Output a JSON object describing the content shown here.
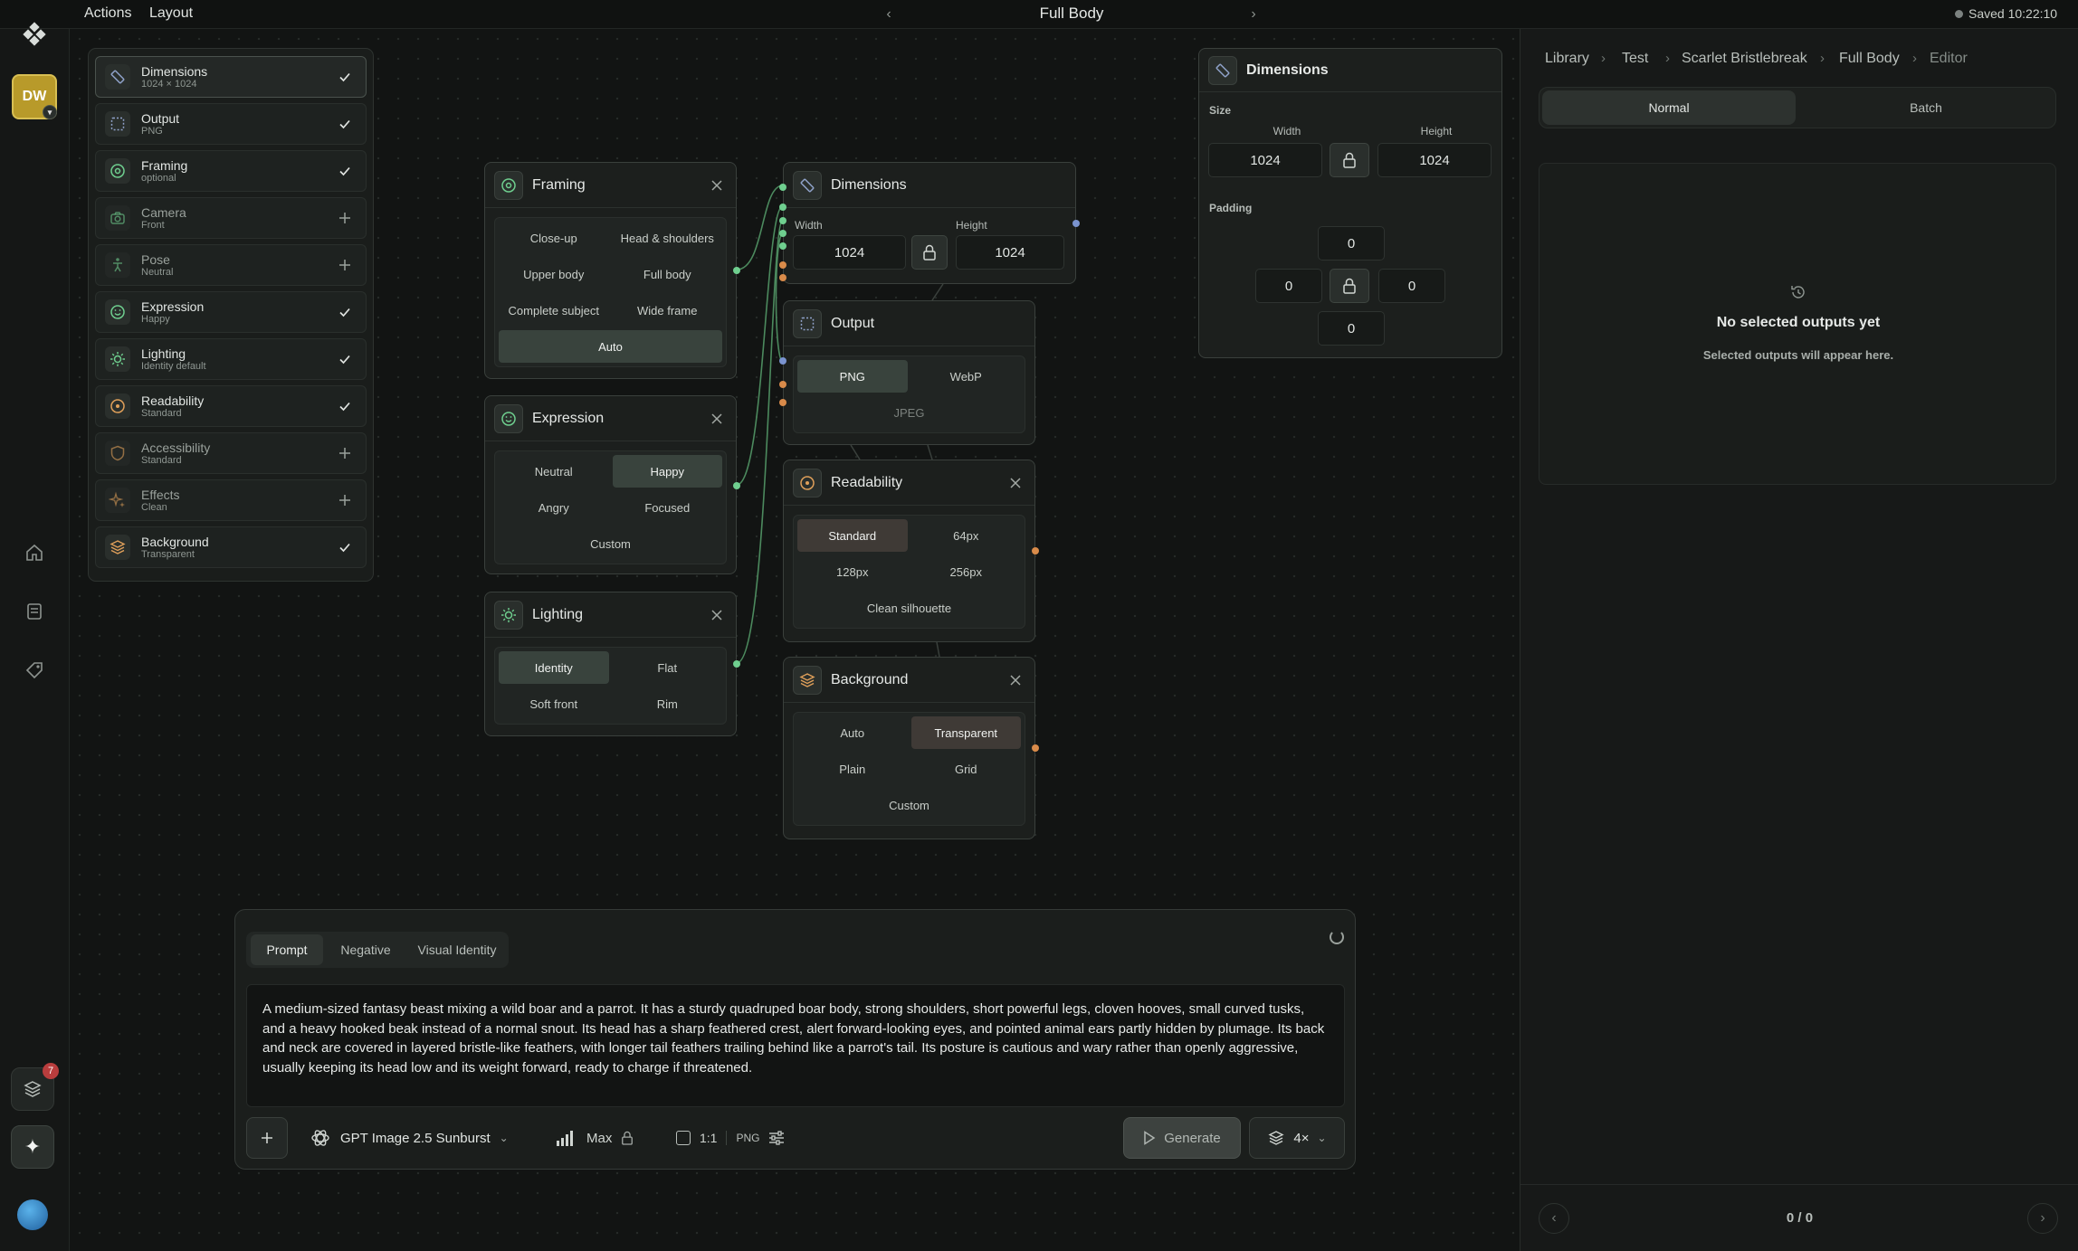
{
  "topbar": {
    "menu": [
      "Actions",
      "Layout"
    ],
    "title": "Full Body",
    "saved": "Saved 10:22:10"
  },
  "rail": {
    "avatar": "DW",
    "badge": "7"
  },
  "steps": [
    {
      "label": "Dimensions",
      "sub": "1024 × 1024",
      "state": "done",
      "icon": "ruler-icon",
      "color": "#8fa2c9"
    },
    {
      "label": "Output",
      "sub": "PNG",
      "state": "done",
      "icon": "output-frame-icon",
      "color": "#8fa2c9"
    },
    {
      "label": "Framing",
      "sub": "optional",
      "state": "done",
      "icon": "framing-target-icon",
      "color": "#6fcf8f"
    },
    {
      "label": "Camera",
      "sub": "Front",
      "state": "add",
      "icon": "camera-icon",
      "color": "#6fcf8f"
    },
    {
      "label": "Pose",
      "sub": "Neutral",
      "state": "add",
      "icon": "pose-figure-icon",
      "color": "#6fcf8f"
    },
    {
      "label": "Expression",
      "sub": "Happy",
      "state": "done",
      "icon": "smile-icon",
      "color": "#6fcf8f"
    },
    {
      "label": "Lighting",
      "sub": "Identity default",
      "state": "done",
      "icon": "sun-icon",
      "color": "#6fcf8f"
    },
    {
      "label": "Readability",
      "sub": "Standard",
      "state": "done",
      "icon": "readability-icon",
      "color": "#e0a05a"
    },
    {
      "label": "Accessibility",
      "sub": "Standard",
      "state": "add",
      "icon": "shield-icon",
      "color": "#e0a05a"
    },
    {
      "label": "Effects",
      "sub": "Clean",
      "state": "add",
      "icon": "sparkle-effects-icon",
      "color": "#e0a05a"
    },
    {
      "label": "Background",
      "sub": "Transparent",
      "state": "done",
      "icon": "layers-icon",
      "color": "#e0a05a"
    }
  ],
  "nodes": {
    "framing": {
      "title": "Framing",
      "options": [
        "Close-up",
        "Head & shoulders",
        "Upper body",
        "Full body",
        "Complete subject",
        "Wide frame"
      ],
      "auto": "Auto"
    },
    "expression": {
      "title": "Expression",
      "options": [
        "Neutral",
        "Happy",
        "Angry",
        "Focused"
      ],
      "custom": "Custom"
    },
    "lighting": {
      "title": "Lighting",
      "options": [
        "Identity",
        "Flat",
        "Soft front",
        "Rim"
      ]
    },
    "dimensions": {
      "title": "Dimensions",
      "width_label": "Width",
      "height_label": "Height",
      "width": "1024",
      "height": "1024"
    },
    "output": {
      "title": "Output",
      "options": [
        "PNG",
        "WebP"
      ],
      "jpeg": "JPEG"
    },
    "readability": {
      "title": "Readability",
      "options": [
        "Standard",
        "64px",
        "128px",
        "256px"
      ],
      "clean": "Clean silhouette"
    },
    "background": {
      "title": "Background",
      "options": [
        "Auto",
        "Transparent",
        "Plain",
        "Grid"
      ],
      "custom": "Custom"
    }
  },
  "inspector": {
    "title": "Dimensions",
    "size_label": "Size",
    "width_label": "Width",
    "height_label": "Height",
    "width": "1024",
    "height": "1024",
    "padding_label": "Padding",
    "pad_top": "0",
    "pad_left": "0",
    "pad_right": "0",
    "pad_bottom": "0"
  },
  "prompt": {
    "tabs": [
      "Prompt",
      "Negative",
      "Visual Identity"
    ],
    "text": "A medium-sized fantasy beast mixing a wild boar and a parrot. It has a sturdy quadruped boar body, strong shoulders, short powerful legs, cloven hooves, small curved tusks, and a heavy hooked beak instead of a normal snout. Its head has a sharp feathered crest, alert forward-looking eyes, and pointed animal ears partly hidden by plumage. Its back and neck are covered in layered bristle-like feathers, with longer tail feathers trailing behind like a parrot's tail. Its posture is cautious and wary rather than openly aggressive, usually keeping its head low and its weight forward, ready to charge if threatened.",
    "model": "GPT Image 2.5 Sunburst",
    "quality": "Max",
    "ratio": "1:1",
    "format": "PNG",
    "generate": "Generate",
    "count": "4×"
  },
  "panel": {
    "breadcrumb": [
      "Library",
      "Test",
      "Scarlet Bristlebreak",
      "Full Body",
      "Editor"
    ],
    "tabs": [
      "Normal",
      "Batch"
    ],
    "empty_title": "No selected outputs yet",
    "empty_sub": "Selected outputs will appear here.",
    "pager": "0 / 0"
  }
}
